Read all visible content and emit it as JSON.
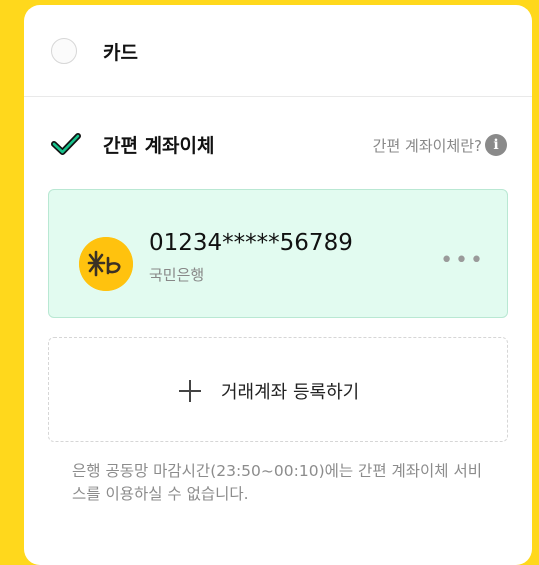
{
  "payment_methods": {
    "card": {
      "label": "카드",
      "selected": false
    },
    "easy_transfer": {
      "label": "간편 계좌이체",
      "selected": true,
      "help_link": "간편 계좌이체란?",
      "help_icon": "i"
    }
  },
  "account": {
    "number": "01234*****56789",
    "bank_name": "국민은행",
    "logo_icon": "kb-bank-logo",
    "more_icon": "•••"
  },
  "register": {
    "label": "거래계좌 등록하기"
  },
  "notice": "은행 공동망 마감시간(23:50~00:10)에는 간편 계좌이체 서비스를 이용하실 수 없습니다.",
  "colors": {
    "background": "#FFD81C",
    "selected_account_bg": "#E2FBF0",
    "check": "#18C28C",
    "bank_logo": "#FFC20E"
  }
}
